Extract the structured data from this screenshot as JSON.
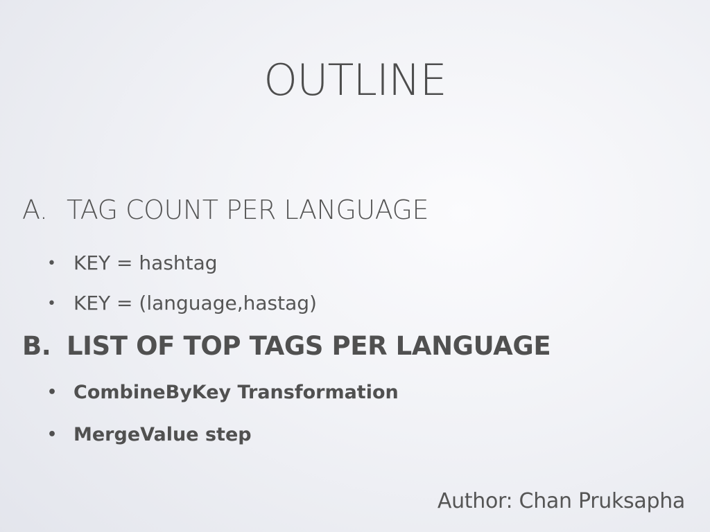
{
  "slide": {
    "title": "OUTLINE",
    "sections": [
      {
        "marker": "A.",
        "heading": "TAG COUNT PER LANGUAGE",
        "bullets": [
          "KEY = hashtag",
          "KEY = (language,hastag)"
        ]
      },
      {
        "marker": "B.",
        "heading": "LIST OF TOP TAGS PER LANGUAGE",
        "bullets": [
          "CombineByKey Transformation",
          "MergeValue step"
        ]
      }
    ],
    "bullet_glyph": "•",
    "author": "Author: Chan Pruksapha"
  }
}
